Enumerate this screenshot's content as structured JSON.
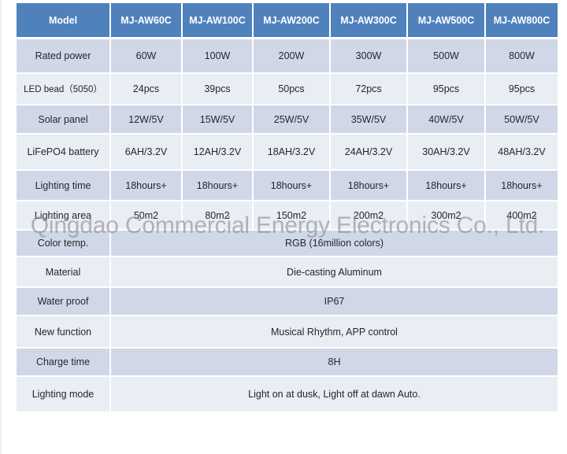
{
  "table": {
    "header": {
      "label": "Model",
      "models": [
        "MJ-AW60C",
        "MJ-AW100C",
        "MJ-AW200C",
        "MJ-AW300C",
        "MJ-AW500C",
        "MJ-AW800C"
      ]
    },
    "per_model_rows": [
      {
        "label": "Rated power",
        "values": [
          "60W",
          "100W",
          "200W",
          "300W",
          "500W",
          "800W"
        ]
      },
      {
        "label": "LED bead（5050）",
        "values": [
          "24pcs",
          "39pcs",
          "50pcs",
          "72pcs",
          "95pcs",
          "95pcs"
        ]
      },
      {
        "label": "Solar panel",
        "values": [
          "12W/5V",
          "15W/5V",
          "25W/5V",
          "35W/5V",
          "40W/5V",
          "50W/5V"
        ]
      },
      {
        "label": "LiFePO4 battery",
        "values": [
          "6AH/3.2V",
          "12AH/3.2V",
          "18AH/3.2V",
          "24AH/3.2V",
          "30AH/3.2V",
          "48AH/3.2V"
        ]
      },
      {
        "label": "Lighting time",
        "values": [
          "18hours+",
          "18hours+",
          "18hours+",
          "18hours+",
          "18hours+",
          "18hours+"
        ]
      },
      {
        "label": "Lighting area",
        "values": [
          "50m2",
          "80m2",
          "150m2",
          "200m2",
          "300m2",
          "400m2"
        ]
      }
    ],
    "shared_rows": [
      {
        "label": "Color temp.",
        "value": "RGB (16million colors)"
      },
      {
        "label": "Material",
        "value": "Die-casting Aluminum"
      },
      {
        "label": "Water proof",
        "value": "IP67"
      },
      {
        "label": "New function",
        "value": "Musical Rhythm, APP control"
      },
      {
        "label": "Charge time",
        "value": "8H"
      },
      {
        "label": "Lighting mode",
        "value": "Light on at dusk, Light off at dawn Auto."
      }
    ]
  },
  "watermark": "Qingdao Commercial Energy Electronics Co., Ltd.",
  "colors": {
    "header_bg": "#4f81bd",
    "header_text": "#ffffff",
    "row_dark": "#d0d8e8",
    "row_light": "#e9edf4",
    "body_text": "#262626"
  }
}
